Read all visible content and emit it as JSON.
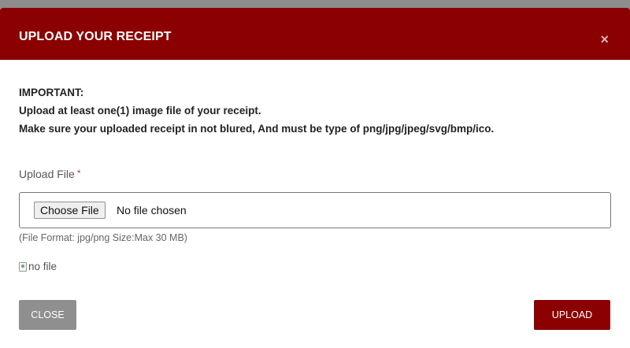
{
  "modal": {
    "title": "UPLOAD YOUR RECEIPT",
    "close_icon": "×",
    "notice": {
      "heading": "IMPORTANT:",
      "line1": "Upload at least one(1) image file of your receipt.",
      "line2": "Make sure your uploaded receipt in not blured, And must be type of png/jpg/jpeg/svg/bmp/ico."
    },
    "upload_label": "Upload File",
    "required_mark": "*",
    "file_input": {
      "button_label": "Choose File",
      "status": "No file chosen"
    },
    "hint": "(File Format: jpg/png Size:Max 30 MB)",
    "preview_alt": "no file",
    "buttons": {
      "close": "CLOSE",
      "upload": "UPLOAD"
    }
  },
  "colors": {
    "header_bg": "#8b0000",
    "upload_button_bg": "#8b0000",
    "close_button_bg": "#8f8f8f",
    "required": "#c0392b"
  }
}
